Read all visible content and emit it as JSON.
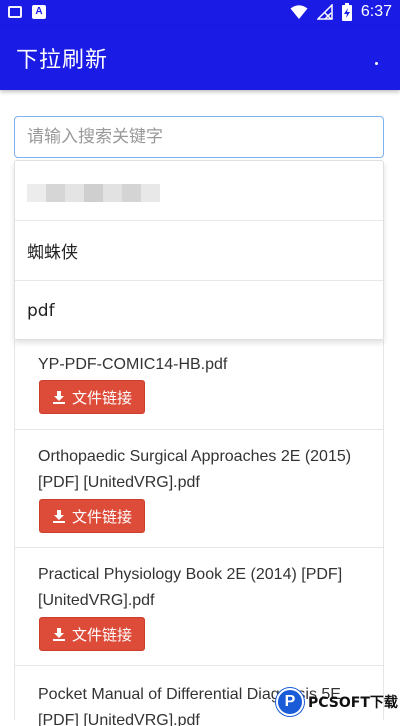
{
  "status_bar": {
    "time": "6:37",
    "icons": [
      "notification-icon",
      "app-a-icon",
      "wifi-icon",
      "no-signal-icon",
      "battery-charging-icon"
    ]
  },
  "app_bar": {
    "title": "下拉刷新",
    "menu_icon": "overflow-menu-icon"
  },
  "search": {
    "value": "",
    "placeholder": "请输入搜索关键字"
  },
  "suggestions": [
    {
      "label": "",
      "note": "blurred"
    },
    {
      "label": "蜘蛛侠"
    },
    {
      "label": "pdf"
    }
  ],
  "results": [
    {
      "title": "YP-PDF-COMIC14-HB.pdf",
      "button": "文件链接"
    },
    {
      "title": "Orthopaedic Surgical Approaches 2E (2015) [PDF] [UnitedVRG].pdf",
      "button": "文件链接"
    },
    {
      "title": "Practical Physiology Book 2E (2014) [PDF] [UnitedVRG].pdf",
      "button": "文件链接"
    },
    {
      "title": "Pocket Manual of Differential Diagnosis 5E [PDF] [UnitedVRG].pdf"
    }
  ],
  "watermark": {
    "logo_letter": "P",
    "text": "PCSOFT下载"
  },
  "colors": {
    "primary": "#1b1be6",
    "button": "#dd4b39",
    "search_border": "#7fb0ef"
  }
}
